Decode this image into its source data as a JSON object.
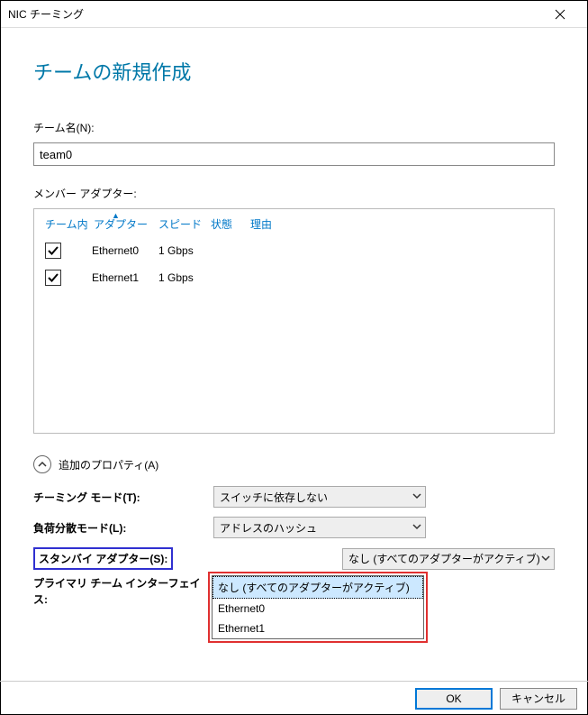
{
  "window": {
    "title": "NIC チーミング"
  },
  "heading": "チームの新規作成",
  "teamName": {
    "label": "チーム名(N):",
    "value": "team0"
  },
  "memberAdapters": {
    "label": "メンバー アダプター:",
    "columns": {
      "team": "チーム内",
      "adapter": "アダプター",
      "speed": "スピード",
      "state": "状態",
      "reason": "理由"
    },
    "rows": [
      {
        "checked": true,
        "name": "Ethernet0",
        "speed": "1 Gbps"
      },
      {
        "checked": true,
        "name": "Ethernet1",
        "speed": "1 Gbps"
      }
    ]
  },
  "additionalProps": {
    "toggleLabel": "追加のプロパティ(A)",
    "teamingMode": {
      "label": "チーミング モード(T):",
      "value": "スイッチに依存しない"
    },
    "loadBalance": {
      "label": "負荷分散モード(L):",
      "value": "アドレスのハッシュ"
    },
    "standby": {
      "label": "スタンバイ アダプター(S):",
      "value": "なし (すべてのアダプターがアクティブ)",
      "options": [
        "なし (すべてのアダプターがアクティブ)",
        "Ethernet0",
        "Ethernet1"
      ]
    },
    "primaryInterface": {
      "label": "プライマリ チーム インターフェイス:"
    }
  },
  "buttons": {
    "ok": "OK",
    "cancel": "キャンセル"
  }
}
